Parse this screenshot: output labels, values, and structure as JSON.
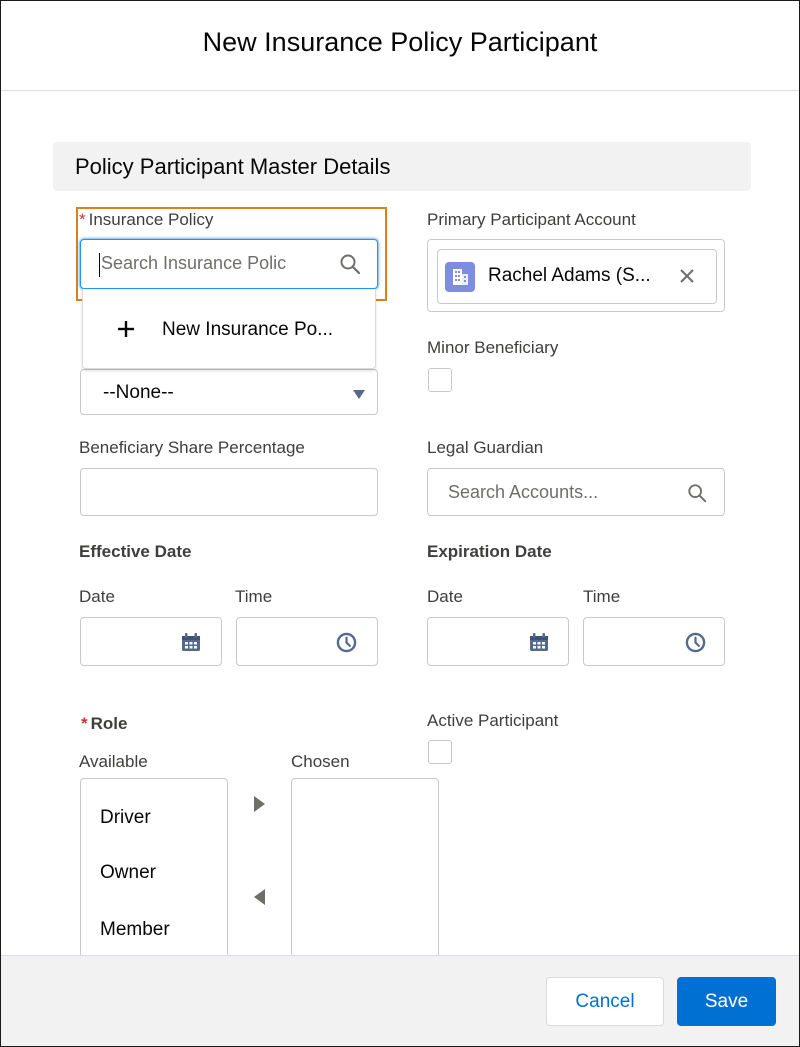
{
  "modal": {
    "title": "New Insurance Policy Participant"
  },
  "section": {
    "title": "Policy Participant Master Details"
  },
  "insurance_policy": {
    "label": "Insurance Policy",
    "required_mark": "*",
    "placeholder": "Search Insurance Polic",
    "dropdown_new": "New Insurance Po..."
  },
  "primary_account": {
    "label": "Primary Participant Account",
    "value": "Rachel Adams (S..."
  },
  "select_field": {
    "value": "--None--"
  },
  "minor_beneficiary": {
    "label": "Minor Beneficiary"
  },
  "beneficiary_share": {
    "label": "Beneficiary Share Percentage"
  },
  "legal_guardian": {
    "label": "Legal Guardian",
    "placeholder": "Search Accounts..."
  },
  "effective_date": {
    "label": "Effective Date",
    "date_label": "Date",
    "time_label": "Time"
  },
  "expiration_date": {
    "label": "Expiration Date",
    "date_label": "Date",
    "time_label": "Time"
  },
  "role": {
    "label": "Role",
    "required_mark": "*",
    "available_label": "Available",
    "chosen_label": "Chosen",
    "available_options": [
      "Driver",
      "Owner",
      "Member"
    ]
  },
  "active_participant": {
    "label": "Active Participant"
  },
  "footer": {
    "cancel_label": "Cancel",
    "save_label": "Save"
  },
  "colors": {
    "brand": "#0070d2",
    "required": "#c23934",
    "focus_outline": "#e07e18",
    "account_icon": "#7f8de1"
  }
}
